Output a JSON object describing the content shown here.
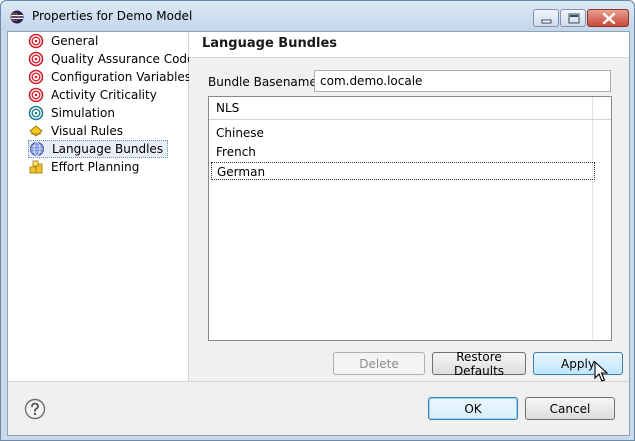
{
  "window": {
    "title": "Properties for Demo Model"
  },
  "tree": {
    "items": [
      {
        "label": "General",
        "icon": "spiral-red-icon"
      },
      {
        "label": "Quality Assurance Codes",
        "icon": "spiral-red-icon"
      },
      {
        "label": "Configuration Variables",
        "icon": "spiral-red-icon"
      },
      {
        "label": "Activity Criticality",
        "icon": "spiral-red-icon"
      },
      {
        "label": "Simulation",
        "icon": "spiral-teal-icon"
      },
      {
        "label": "Visual Rules",
        "icon": "diamond-yellow-icon"
      },
      {
        "label": "Language Bundles",
        "icon": "globe-icon",
        "selected": true
      },
      {
        "label": "Effort Planning",
        "icon": "coins-icon"
      }
    ]
  },
  "page": {
    "title": "Language Bundles",
    "basename_label": "Bundle Basename:",
    "basename_value": "com.demo.locale",
    "list_header": "NLS",
    "list_items": [
      "Chinese",
      "French",
      "German"
    ],
    "focused_index": 2
  },
  "buttons": {
    "delete": "Delete",
    "restore_defaults": "Restore Defaults",
    "apply": "Apply",
    "ok": "OK",
    "cancel": "Cancel"
  },
  "colors": {
    "titlebar": "#c3d6ea",
    "close_button": "#c64a38",
    "selection": "#e8eef7",
    "button_hover": "#bee6fd"
  }
}
